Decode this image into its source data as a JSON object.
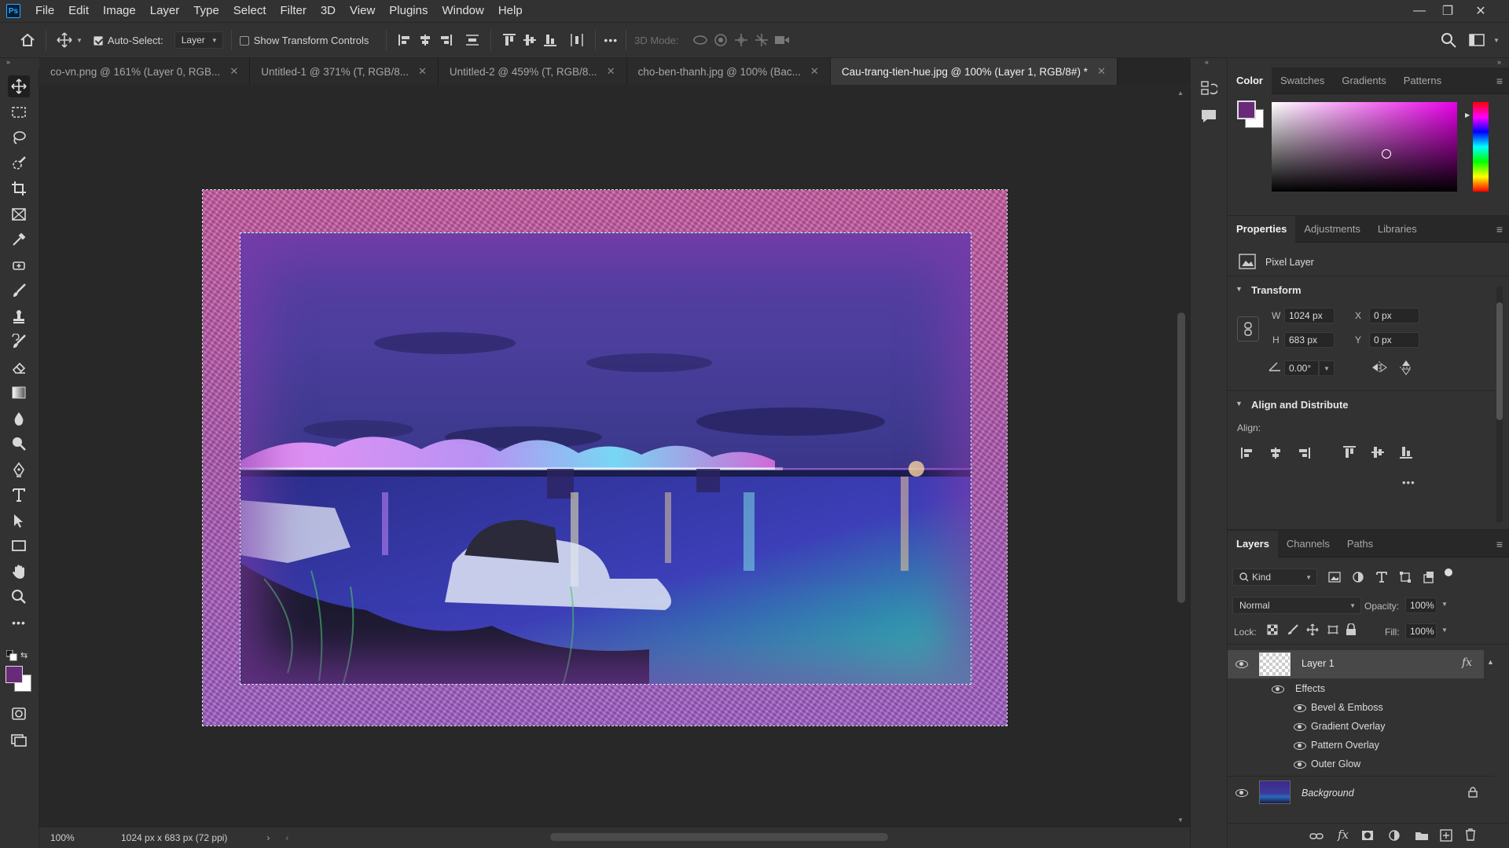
{
  "app": {
    "logo": "Ps"
  },
  "menu": [
    "File",
    "Edit",
    "Image",
    "Layer",
    "Type",
    "Select",
    "Filter",
    "3D",
    "View",
    "Plugins",
    "Window",
    "Help"
  ],
  "options": {
    "auto_select_label": "Auto-Select:",
    "auto_select_checked": true,
    "auto_select_target": "Layer",
    "show_transform_label": "Show Transform Controls",
    "show_transform_checked": false,
    "mode_3d_label": "3D Mode:",
    "more": "•••"
  },
  "tabs": [
    {
      "label": "co-vn.png @ 161% (Layer 0, RGB...",
      "active": false
    },
    {
      "label": "Untitled-1 @ 371% (T, RGB/8...",
      "active": false
    },
    {
      "label": "Untitled-2 @ 459% (T, RGB/8...",
      "active": false
    },
    {
      "label": "cho-ben-thanh.jpg @ 100% (Bac...",
      "active": false
    },
    {
      "label": "Cau-trang-tien-hue.jpg @ 100% (Layer 1, RGB/8#) *",
      "active": true
    }
  ],
  "status": {
    "zoom": "100%",
    "doc_info": "1024 px x 683 px (72 ppi)"
  },
  "colors": {
    "foreground": "#6a2a7a",
    "background": "#ffffff",
    "frame_top": "#d05fa8",
    "frame_bottom": "#a764cf",
    "accent": "#31a8ff"
  },
  "color_panel": {
    "tabs": [
      "Color",
      "Swatches",
      "Gradients",
      "Patterns"
    ]
  },
  "properties": {
    "tabs": [
      "Properties",
      "Adjustments",
      "Libraries"
    ],
    "layer_kind": "Pixel Layer",
    "transform_title": "Transform",
    "w_label": "W",
    "w": "1024 px",
    "h_label": "H",
    "h": "683 px",
    "x_label": "X",
    "x": "0 px",
    "y_label": "Y",
    "y": "0 px",
    "angle": "0.00°",
    "align_title": "Align and Distribute",
    "align_label": "Align:",
    "more": "•••"
  },
  "layers_panel": {
    "tabs": [
      "Layers",
      "Channels",
      "Paths"
    ],
    "kind": "Kind",
    "blend_mode": "Normal",
    "opacity_label": "Opacity:",
    "opacity": "100%",
    "lock_label": "Lock:",
    "fill_label": "Fill:",
    "fill": "100%",
    "layers": [
      {
        "name": "Layer 1",
        "fx": "fx",
        "effects_label": "Effects",
        "effects": [
          "Bevel & Emboss",
          "Gradient Overlay",
          "Pattern Overlay",
          "Outer Glow"
        ]
      },
      {
        "name": "Background"
      }
    ]
  }
}
